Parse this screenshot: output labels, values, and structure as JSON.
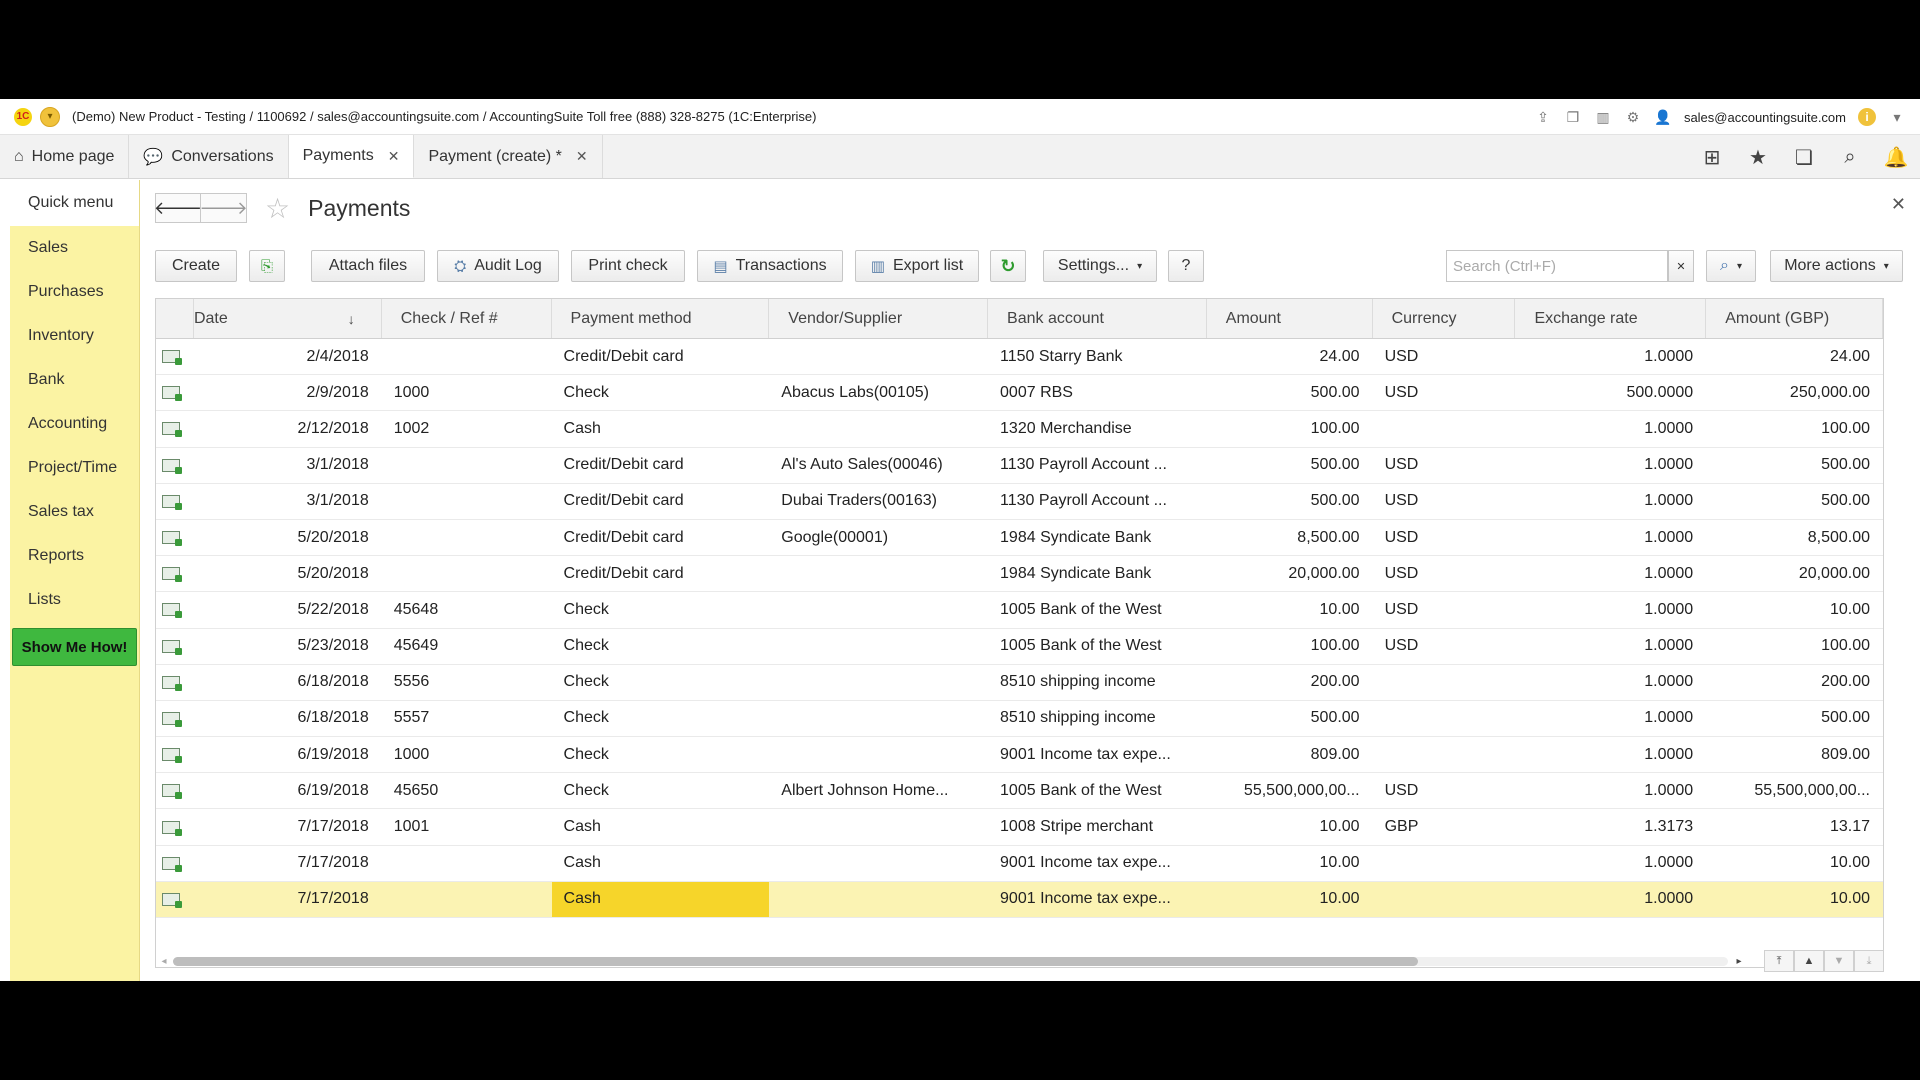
{
  "titlebar": {
    "text": "(Demo) New Product - Testing / 1100692 / sales@accountingsuite.com / AccountingSuite Toll free (888) 328-8275   (1C:Enterprise)",
    "user": "sales@accountingsuite.com"
  },
  "tabs": [
    {
      "label": "Home page",
      "icon": "home-icon"
    },
    {
      "label": "Conversations",
      "icon": "chat-icon"
    },
    {
      "label": "Payments",
      "closable": true,
      "active": true
    },
    {
      "label": "Payment (create) *",
      "closable": true
    }
  ],
  "sidebar": {
    "items": [
      "Quick menu",
      "Sales",
      "Purchases",
      "Inventory",
      "Bank",
      "Accounting",
      "Project/Time",
      "Sales tax",
      "Reports",
      "Lists"
    ],
    "cta": "Show Me How!"
  },
  "page": {
    "title": "Payments"
  },
  "toolbar": {
    "create": "Create",
    "attach": "Attach files",
    "audit": "Audit Log",
    "print": "Print check",
    "transactions": "Transactions",
    "export": "Export list",
    "settings": "Settings...",
    "help": "?",
    "search_placeholder": "Search (Ctrl+F)",
    "more": "More actions"
  },
  "table": {
    "columns": [
      "Date",
      "Check / Ref #",
      "Payment method",
      "Vendor/Supplier",
      "Bank account",
      "Amount",
      "Currency",
      "Exchange rate",
      "Amount (GBP)"
    ],
    "rows": [
      [
        "2/4/2018",
        "",
        "Credit/Debit card",
        "",
        "1150 Starry Bank",
        "24.00",
        "USD",
        "1.0000",
        "24.00"
      ],
      [
        "2/9/2018",
        "1000",
        "Check",
        "Abacus Labs(00105)",
        "0007 RBS",
        "500.00",
        "USD",
        "500.0000",
        "250,000.00"
      ],
      [
        "2/12/2018",
        "1002",
        "Cash",
        "",
        "1320 Merchandise",
        "100.00",
        "",
        "1.0000",
        "100.00"
      ],
      [
        "3/1/2018",
        "",
        "Credit/Debit card",
        "Al's Auto Sales(00046)",
        "1130 Payroll Account ...",
        "500.00",
        "USD",
        "1.0000",
        "500.00"
      ],
      [
        "3/1/2018",
        "",
        "Credit/Debit card",
        "Dubai Traders(00163)",
        "1130 Payroll Account ...",
        "500.00",
        "USD",
        "1.0000",
        "500.00"
      ],
      [
        "5/20/2018",
        "",
        "Credit/Debit card",
        "Google(00001)",
        "1984 Syndicate Bank",
        "8,500.00",
        "USD",
        "1.0000",
        "8,500.00"
      ],
      [
        "5/20/2018",
        "",
        "Credit/Debit card",
        "",
        "1984 Syndicate Bank",
        "20,000.00",
        "USD",
        "1.0000",
        "20,000.00"
      ],
      [
        "5/22/2018",
        "45648",
        "Check",
        "",
        "1005 Bank of the West",
        "10.00",
        "USD",
        "1.0000",
        "10.00"
      ],
      [
        "5/23/2018",
        "45649",
        "Check",
        "",
        "1005 Bank of the West",
        "100.00",
        "USD",
        "1.0000",
        "100.00"
      ],
      [
        "6/18/2018",
        "5556",
        "Check",
        "",
        "8510 shipping income",
        "200.00",
        "",
        "1.0000",
        "200.00"
      ],
      [
        "6/18/2018",
        "5557",
        "Check",
        "",
        "8510 shipping income",
        "500.00",
        "",
        "1.0000",
        "500.00"
      ],
      [
        "6/19/2018",
        "1000",
        "Check",
        "",
        "9001 Income tax expe...",
        "809.00",
        "",
        "1.0000",
        "809.00"
      ],
      [
        "6/19/2018",
        "45650",
        "Check",
        "Albert Johnson Home...",
        "1005 Bank of the West",
        "55,500,000,00...",
        "USD",
        "1.0000",
        "55,500,000,00..."
      ],
      [
        "7/17/2018",
        "1001",
        "Cash",
        "",
        "1008 Stripe merchant",
        "10.00",
        "GBP",
        "1.3173",
        "13.17"
      ],
      [
        "7/17/2018",
        "",
        "Cash",
        "",
        "9001 Income tax expe...",
        "10.00",
        "",
        "1.0000",
        "10.00"
      ],
      [
        "7/17/2018",
        "",
        "Cash",
        "",
        "9001 Income tax expe...",
        "10.00",
        "",
        "1.0000",
        "10.00"
      ]
    ],
    "selected_row": 15
  },
  "colors": {
    "sidebar": "#fbf3a3",
    "selected_row": "#fbf3b3",
    "selected_cell": "#f6d52a",
    "cta": "#3fb83f"
  }
}
